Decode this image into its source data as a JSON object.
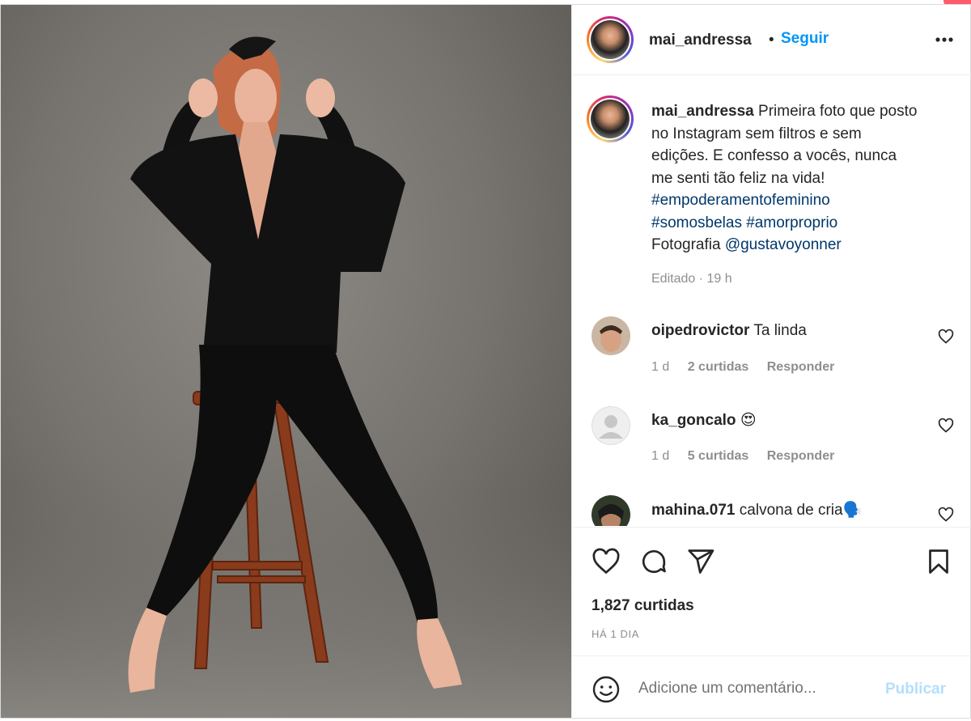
{
  "post": {
    "username": "mai_andressa",
    "follow_label": "Seguir",
    "separator": "•",
    "caption_user": "mai_andressa",
    "caption_text": "Primeira foto que posto no Instagram sem filtros e sem edições. E confesso a vocês, nunca me senti tão feliz na vida!",
    "hashtags": [
      "#empoderamentofeminino",
      "#somosbelas",
      "#amorproprio"
    ],
    "credit_label": "Fotografia",
    "credit_mention": "@gustavoyonner",
    "meta": "Editado · 19 h"
  },
  "comments": [
    {
      "username": "oipedrovictor",
      "text": "Ta linda",
      "age": "1 d",
      "likes": "2 curtidas",
      "reply": "Responder"
    },
    {
      "username": "ka_goncalo",
      "text": "😍",
      "age": "1 d",
      "likes": "5 curtidas",
      "reply": "Responder"
    },
    {
      "username": "mahina.071",
      "text": "calvona de cria🗣️"
    }
  ],
  "footer": {
    "likes": "1,827 curtidas",
    "time": "HÁ 1 DIA",
    "comment_placeholder": "Adicione um comentário...",
    "publish_label": "Publicar"
  },
  "icons": {
    "like": "heart-icon",
    "comment": "comment-bubble-icon",
    "share": "paper-plane-icon",
    "save": "bookmark-icon",
    "more": "more-options-icon",
    "emoji": "emoji-icon"
  },
  "colors": {
    "accent": "#0095f6",
    "hashtag": "#00376b",
    "muted": "#8e8e8e",
    "publish_disabled": "#b2dffc"
  }
}
